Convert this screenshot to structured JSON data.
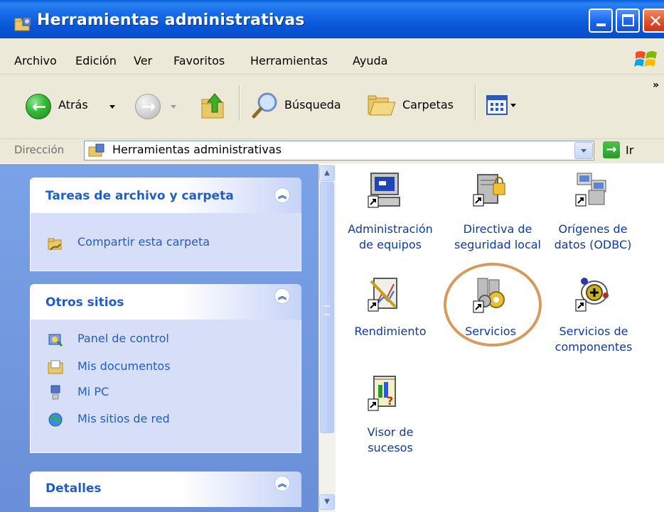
{
  "window": {
    "title": "Herramientas administrativas",
    "icon": "admin-tools-folder-icon",
    "controls": [
      "minimize",
      "maximize",
      "close"
    ]
  },
  "menubar": {
    "items": [
      "Archivo",
      "Edición",
      "Ver",
      "Favoritos",
      "Herramientas",
      "Ayuda"
    ]
  },
  "toolbar": {
    "back_label": "Atrás",
    "search_label": "Búsqueda",
    "folders_label": "Carpetas",
    "overflow": "»"
  },
  "address": {
    "label": "Dirección",
    "value": "Herramientas administrativas",
    "go_label": "Ir"
  },
  "taskpane": {
    "panels": [
      {
        "title": "Tareas de archivo y carpeta",
        "items": [
          {
            "label": "Compartir esta carpeta",
            "icon": "share-folder-icon"
          }
        ]
      },
      {
        "title": "Otros sitios",
        "items": [
          {
            "label": "Panel de control",
            "icon": "control-panel-icon"
          },
          {
            "label": "Mis documentos",
            "icon": "my-documents-icon"
          },
          {
            "label": "Mi PC",
            "icon": "my-computer-icon"
          },
          {
            "label": "Mis sitios de red",
            "icon": "network-places-icon"
          }
        ]
      },
      {
        "title": "Detalles",
        "items": []
      }
    ]
  },
  "files": [
    {
      "label": "Administración\nde equipos",
      "icon": "computer-management-icon"
    },
    {
      "label": "Directiva de\nseguridad local",
      "icon": "local-security-policy-icon"
    },
    {
      "label": "Orígenes de\ndatos (ODBC)",
      "icon": "odbc-data-sources-icon"
    },
    {
      "label": "Rendimiento",
      "icon": "performance-icon"
    },
    {
      "label": "Servicios",
      "icon": "services-icon",
      "highlighted": true
    },
    {
      "label": "Servicios de\ncomponentes",
      "icon": "component-services-icon"
    },
    {
      "label": "Visor de\nsucesos",
      "icon": "event-viewer-icon"
    }
  ],
  "colors": {
    "titlebar": "#0a56d6",
    "taskpane_bg": "#7ba2e7",
    "panel_title": "#215dc6",
    "link_text": "#0c3ba3",
    "highlight_ring": "#d69b5c"
  }
}
